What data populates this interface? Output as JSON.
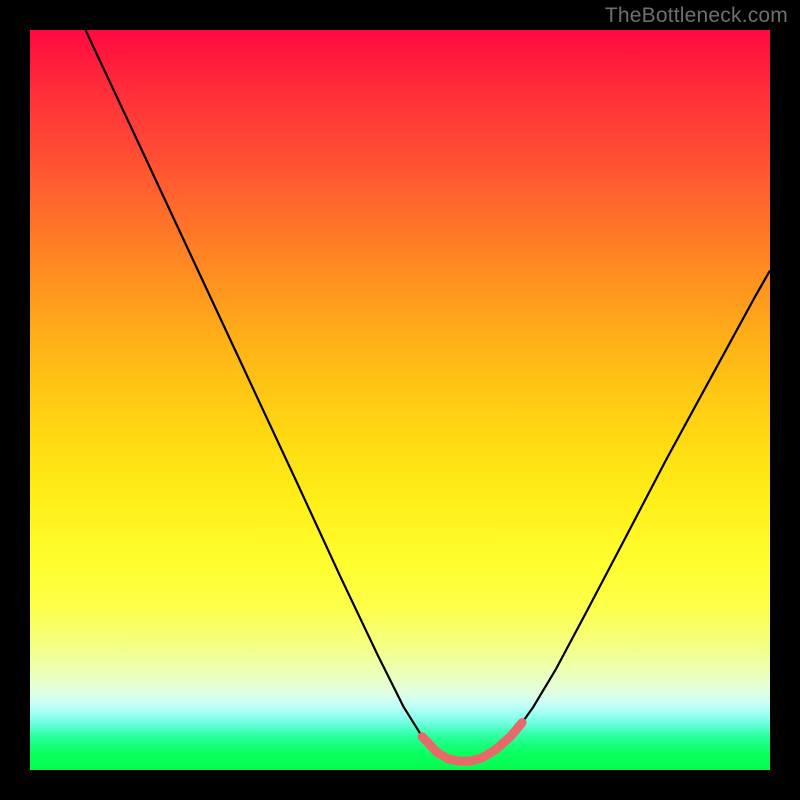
{
  "watermark": {
    "text": "TheBottleneck.com"
  },
  "chart_data": {
    "type": "line",
    "title": "",
    "xlabel": "",
    "ylabel": "",
    "xlim": [
      0,
      100
    ],
    "ylim": [
      0,
      100
    ],
    "grid": false,
    "legend": false,
    "series": [
      {
        "name": "black-curve",
        "color": "#000000",
        "width": 2.2,
        "x": [
          7.5,
          15,
          22,
          29,
          36,
          42,
          47,
          50.5,
          53,
          55,
          56.5,
          58,
          59.5,
          61,
          63,
          65,
          66.5,
          68,
          71,
          75,
          80,
          86,
          92,
          98,
          100
        ],
        "y": [
          100,
          84,
          69,
          54,
          39,
          26,
          15.5,
          8.5,
          4.5,
          2.4,
          1.5,
          1.2,
          1.2,
          1.6,
          2.8,
          4.6,
          6.4,
          8.5,
          13.5,
          21,
          30.5,
          42,
          53,
          64,
          67.5
        ]
      },
      {
        "name": "pink-highlight",
        "color": "#e66a6a",
        "width": 9,
        "linecap": "round",
        "x": [
          53,
          55,
          56.5,
          58,
          59.5,
          61,
          63,
          65,
          66.5
        ],
        "y": [
          4.5,
          2.4,
          1.5,
          1.2,
          1.2,
          1.6,
          2.8,
          4.6,
          6.4
        ]
      }
    ],
    "background": {
      "type": "vertical-gradient",
      "description": "red at top through orange, yellow, pale green bands to bright green at bottom",
      "stops": [
        {
          "pos": 0.0,
          "color": "#ff0a40"
        },
        {
          "pos": 0.5,
          "color": "#ffd014"
        },
        {
          "pos": 0.78,
          "color": "#fdff4a"
        },
        {
          "pos": 0.9,
          "color": "#d6ffee"
        },
        {
          "pos": 1.0,
          "color": "#04fc4e"
        }
      ]
    }
  }
}
